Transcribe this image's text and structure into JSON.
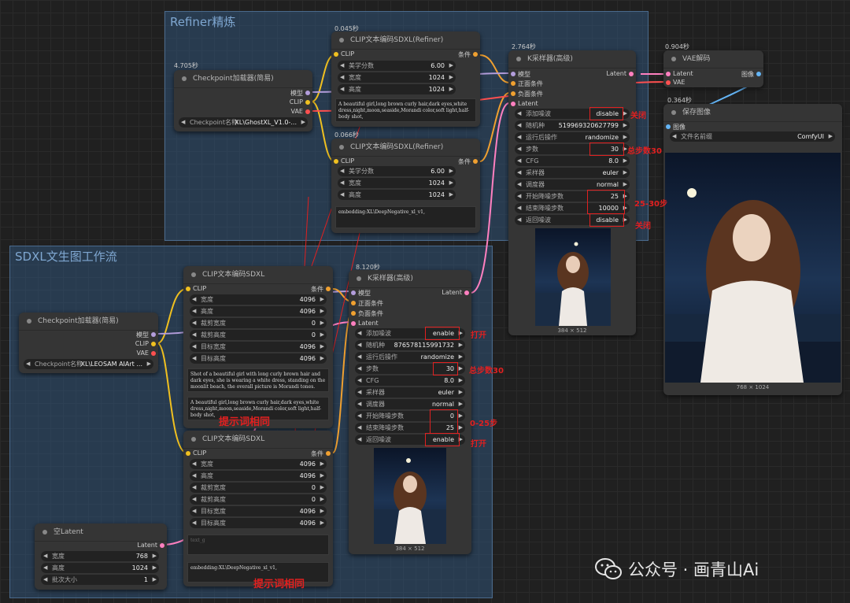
{
  "groups": {
    "refiner": "Refiner精炼",
    "sdxl": "SDXL文生图工作流"
  },
  "nodes": {
    "ckpt_refiner": {
      "time": "4.705秒",
      "title": "Checkpoint加载器(简易)",
      "out_model": "模型",
      "out_clip": "CLIP",
      "out_vae": "VAE",
      "w": {
        "label": "Checkpoint名称",
        "value": "XL\\GhostXL_V1.0-..."
      }
    },
    "clip_ref_pos": {
      "time": "0.045秒",
      "title": "CLIP文本编码SDXL(Refiner)",
      "in": "CLIP",
      "out": "条件",
      "widgets": [
        {
          "l": "美学分数",
          "v": "6.00"
        },
        {
          "l": "宽度",
          "v": "1024"
        },
        {
          "l": "高度",
          "v": "1024"
        }
      ],
      "text": "A beautiful girl,long brown curly hair,dark eyes,white dress,night,moon,seaside,Morandi color,soft light,half-body shot,"
    },
    "clip_ref_neg": {
      "time": "0.066秒",
      "title": "CLIP文本编码SDXL(Refiner)",
      "in": "CLIP",
      "out": "条件",
      "widgets": [
        {
          "l": "美学分数",
          "v": "6.00"
        },
        {
          "l": "宽度",
          "v": "1024"
        },
        {
          "l": "高度",
          "v": "1024"
        }
      ],
      "text": "embedding:XL\\DeepNegative_xl_v1,"
    },
    "ksampler_ref": {
      "time": "2.764秒",
      "title": "K采样器(高级)",
      "in_model": "模型",
      "in_pos": "正面条件",
      "in_neg": "负面条件",
      "in_latent": "Latent",
      "out": "Latent",
      "widgets": [
        {
          "l": "添加噪波",
          "v": "disable"
        },
        {
          "l": "随机种",
          "v": "519969320627799"
        },
        {
          "l": "运行后操作",
          "v": "randomize"
        },
        {
          "l": "步数",
          "v": "30"
        },
        {
          "l": "CFG",
          "v": "8.0"
        },
        {
          "l": "采样器",
          "v": "euler"
        },
        {
          "l": "调度器",
          "v": "normal"
        },
        {
          "l": "开始降噪步数",
          "v": "25"
        },
        {
          "l": "结束降噪步数",
          "v": "10000"
        },
        {
          "l": "返回噪波",
          "v": "disable"
        }
      ],
      "caption": "384 × 512"
    },
    "vae": {
      "time": "0.904秒",
      "title": "VAE解码",
      "in_latent": "Latent",
      "in_vae": "VAE",
      "out": "图像"
    },
    "save": {
      "time": "0.364秒",
      "title": "保存图像",
      "in": "图像",
      "w": {
        "label": "文件名前缀",
        "value": "ComfyUI"
      },
      "caption": "768 × 1024"
    },
    "ckpt_sdxl": {
      "title": "Checkpoint加载器(简易)",
      "out_model": "模型",
      "out_clip": "CLIP",
      "out_vae": "VAE",
      "w": {
        "label": "Checkpoint名称",
        "value": "XL\\LEOSAM AIArt ..."
      }
    },
    "clip_sdxl_pos": {
      "title": "CLIP文本编码SDXL",
      "in": "CLIP",
      "out": "条件",
      "widgets": [
        {
          "l": "宽度",
          "v": "4096"
        },
        {
          "l": "高度",
          "v": "4096"
        },
        {
          "l": "裁剪宽度",
          "v": "0"
        },
        {
          "l": "裁剪高度",
          "v": "0"
        },
        {
          "l": "目标宽度",
          "v": "4096"
        },
        {
          "l": "目标高度",
          "v": "4096"
        }
      ],
      "text1": "Shot of a beautiful girl with long curly brown hair and dark eyes, she is wearing a white dress, standing on the moonlit beach, the overall picture is Morandi tones.",
      "text2": "A beautiful girl,long brown curly hair,dark eyes,white dress,night,moon,seaside,Morandi color,soft light,half-body shot,"
    },
    "clip_sdxl_neg": {
      "title": "CLIP文本编码SDXL",
      "in": "CLIP",
      "out": "条件",
      "widgets": [
        {
          "l": "宽度",
          "v": "4096"
        },
        {
          "l": "高度",
          "v": "4096"
        },
        {
          "l": "裁剪宽度",
          "v": "0"
        },
        {
          "l": "裁剪高度",
          "v": "0"
        },
        {
          "l": "目标宽度",
          "v": "4096"
        },
        {
          "l": "目标高度",
          "v": "4096"
        }
      ],
      "text1": "text_g",
      "text2": "embedding:XL\\DeepNegative_xl_v1,"
    },
    "ksampler_sdxl": {
      "time": "8.120秒",
      "title": "K采样器(高级)",
      "in_model": "模型",
      "in_pos": "正面条件",
      "in_neg": "负面条件",
      "in_latent": "Latent",
      "out": "Latent",
      "widgets": [
        {
          "l": "添加噪波",
          "v": "enable"
        },
        {
          "l": "随机种",
          "v": "876578115991732"
        },
        {
          "l": "运行后操作",
          "v": "randomize"
        },
        {
          "l": "步数",
          "v": "30"
        },
        {
          "l": "CFG",
          "v": "8.0"
        },
        {
          "l": "采样器",
          "v": "euler"
        },
        {
          "l": "调度器",
          "v": "normal"
        },
        {
          "l": "开始降噪步数",
          "v": "0"
        },
        {
          "l": "结束降噪步数",
          "v": "25"
        },
        {
          "l": "返回噪波",
          "v": "enable"
        }
      ],
      "caption": "384 × 512"
    },
    "empty_latent": {
      "title": "空Latent",
      "out": "Latent",
      "widgets": [
        {
          "l": "宽度",
          "v": "768"
        },
        {
          "l": "高度",
          "v": "1024"
        },
        {
          "l": "批次大小",
          "v": "1"
        }
      ]
    }
  },
  "annotations": {
    "ref_off1": "关闭",
    "ref_steps": "总步数30",
    "ref_range": "25-30步",
    "ref_off2": "关闭",
    "sd_on1": "打开",
    "sd_steps": "总步数30",
    "sd_range": "0-25步",
    "sd_on2": "打开",
    "same_prompt1": "提示词相同",
    "same_prompt2": "提示词相同"
  },
  "watermark": "公众号 · 画青山Ai",
  "colors": {
    "group_bg": "#2f5276",
    "clip_link": "#f0c020",
    "model_link": "#b39ddb",
    "cond_link": "#f0a030",
    "latent_link": "#ff80c0",
    "vae_link": "#ff5050",
    "image_link": "#64b5f6",
    "red": "#e02020"
  }
}
